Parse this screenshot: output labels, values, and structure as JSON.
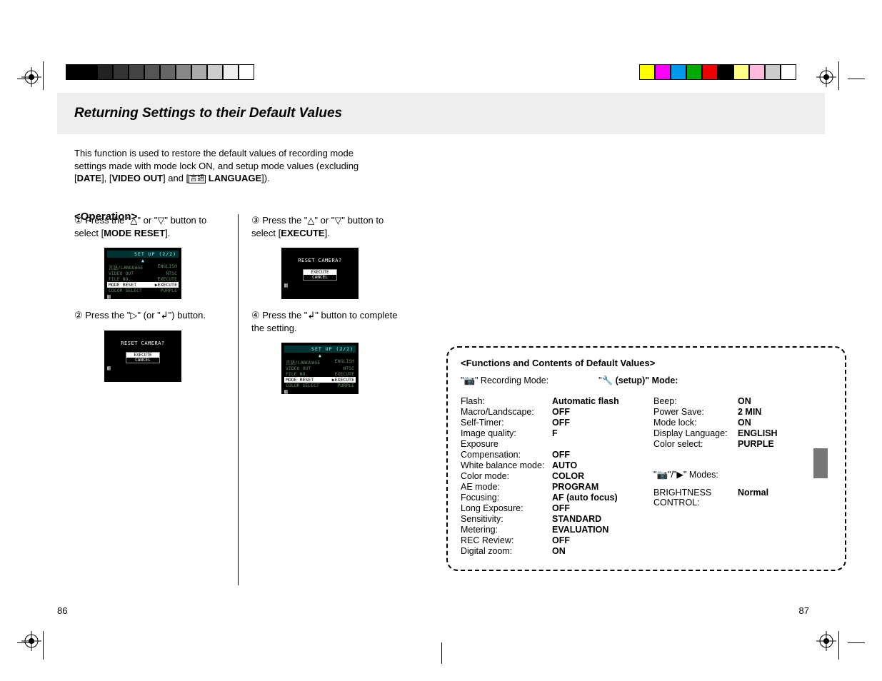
{
  "title": "Returning Settings to their Default Values",
  "intro_line1": "This function is used to restore the default values of recording mode settings made with mode lock ON, and setup mode values (excluding",
  "intro_date": "DATE",
  "intro_sep1": "], [",
  "intro_video": "VIDEO OUT",
  "intro_sep2": "] and [",
  "intro_lang": " LANGUAGE",
  "intro_end": "]).",
  "operation_heading": "<Operation>",
  "steps": {
    "s1_pre": "① Press the \"△\" or \"▽\" button to select [",
    "s1_bold": "MODE RESET",
    "s1_post": "].",
    "s2_full": "② Press the \"▷\" (or \"↲\") button.",
    "s3_pre": "③ Press the \"△\" or \"▽\" button to select [",
    "s3_bold": "EXECUTE",
    "s3_post": "].",
    "s4_full": "④ Press the \"↲\" button to complete the setting."
  },
  "lcd": {
    "setup_head": "SET UP   (2/2)",
    "rows": [
      {
        "l": "言語/LANGUAGE",
        "r": "ENGLISH"
      },
      {
        "l": "VIDEO OUT",
        "r": "NTSC"
      },
      {
        "l": "FILE NO.",
        "r": "EXECUTE"
      },
      {
        "l": "MODE RESET",
        "r": "▶EXECUTE"
      },
      {
        "l": "COLOR SELECT",
        "r": "PURPLE"
      }
    ],
    "reset_title": "RESET CAMERA?",
    "exec": "EXECUTE",
    "cancel": "CANCEL"
  },
  "defaults": {
    "heading": "<Functions and Contents of Default Values>",
    "rec_mode_label": "\" Recording Mode:",
    "setup_mode_label": " (setup)\" Mode:",
    "rec": [
      {
        "l": "Flash:",
        "v": "Automatic flash"
      },
      {
        "l": "Macro/Landscape:",
        "v": "OFF"
      },
      {
        "l": "Self-Timer:",
        "v": "OFF"
      },
      {
        "l": "Image quality:",
        "v": "F"
      },
      {
        "l": "Exposure",
        "v": ""
      },
      {
        "l": "Compensation:",
        "v": "OFF"
      },
      {
        "l": "White balance mode:",
        "v": "AUTO"
      },
      {
        "l": "Color mode:",
        "v": "COLOR"
      },
      {
        "l": "AE mode:",
        "v": "PROGRAM"
      },
      {
        "l": "Focusing:",
        "v": "AF (auto focus)"
      },
      {
        "l": "Long Exposure:",
        "v": "OFF"
      },
      {
        "l": "Sensitivity:",
        "v": "STANDARD"
      },
      {
        "l": "Metering:",
        "v": "EVALUATION"
      },
      {
        "l": "REC Review:",
        "v": "OFF"
      },
      {
        "l": "Digital zoom:",
        "v": "ON"
      }
    ],
    "setup": [
      {
        "l": "Beep:",
        "v": "ON"
      },
      {
        "l": "Power Save:",
        "v": "2 MIN"
      },
      {
        "l": "Mode lock:",
        "v": "ON"
      },
      {
        "l": "Display Language:",
        "v": "ENGLISH"
      },
      {
        "l": "Color select:",
        "v": "PURPLE"
      }
    ],
    "modes2_label": "\"/\"▶\" Modes:",
    "brightness_l": "BRIGHTNESS CONTROL:",
    "brightness_v": "Normal"
  },
  "page_left": "86",
  "page_right": "87",
  "colorbars": {
    "left": [
      "#000",
      "#000",
      "#222",
      "#333",
      "#444",
      "#555",
      "#666",
      "#888",
      "#aaa",
      "#ccc",
      "#eee",
      "#fff"
    ],
    "right": [
      "#ff0",
      "#f0f",
      "#09e",
      "#0a0",
      "#e00",
      "#000",
      "#ff8",
      "#fbd",
      "#ccc",
      "#fff"
    ]
  }
}
